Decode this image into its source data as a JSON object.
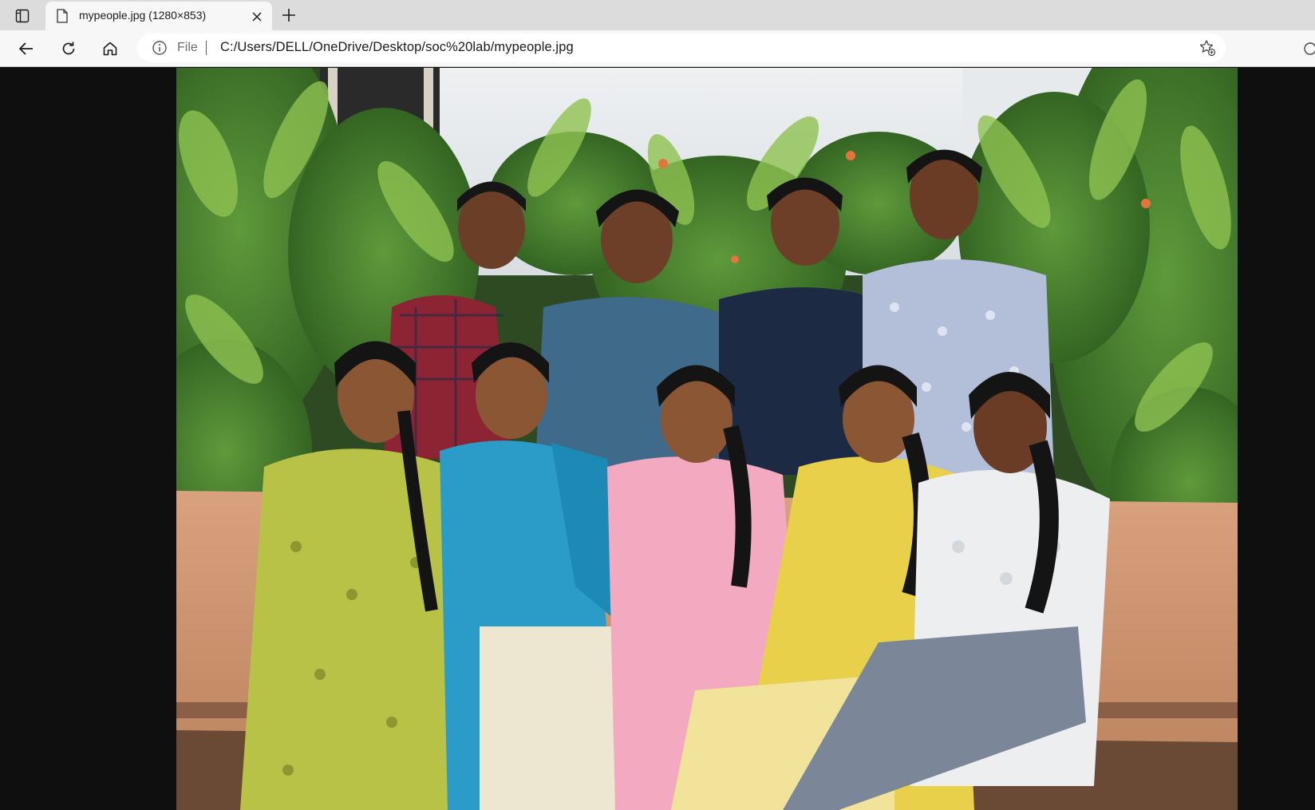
{
  "tab": {
    "title": "mypeople.jpg (1280×853)"
  },
  "address": {
    "scheme_label": "File",
    "url": "C:/Users/DELL/OneDrive/Desktop/soc%20lab/mypeople.jpg"
  },
  "icons": {
    "tab_actions": "tab-actions-icon",
    "favicon": "file-icon",
    "close": "close-icon",
    "new_tab": "plus-icon",
    "back": "back-arrow-icon",
    "refresh": "refresh-icon",
    "home": "home-icon",
    "info": "info-icon",
    "favorites": "add-favorite-icon"
  },
  "colors": {
    "tabstrip": "#dcdcdc",
    "toolbar": "#f7f7f7",
    "viewer_background": "#0f0f0f"
  }
}
